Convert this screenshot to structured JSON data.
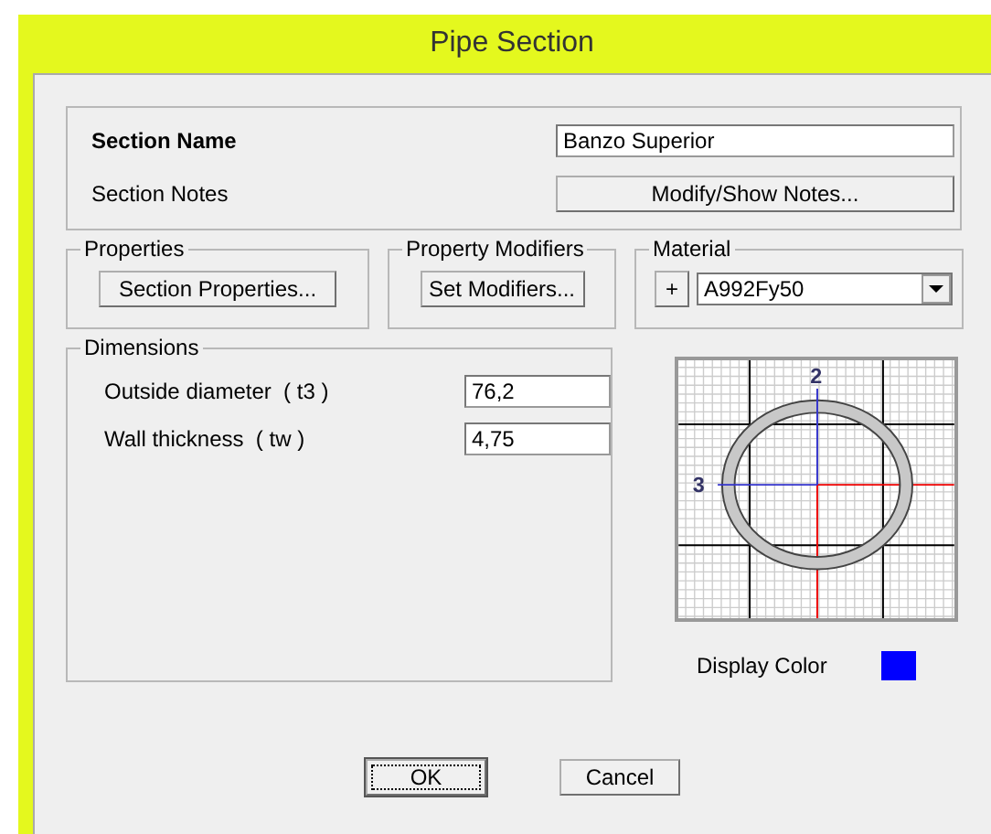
{
  "window": {
    "title": "Pipe Section"
  },
  "section": {
    "name_label": "Section Name",
    "name_value": "Banzo Superior",
    "notes_label": "Section Notes",
    "notes_button": "Modify/Show Notes..."
  },
  "properties": {
    "title": "Properties",
    "button": "Section Properties..."
  },
  "property_modifiers": {
    "title": "Property Modifiers",
    "button": "Set Modifiers..."
  },
  "material": {
    "title": "Material",
    "add_button": "+",
    "value": "A992Fy50"
  },
  "dimensions": {
    "title": "Dimensions",
    "fields": [
      {
        "label": "Outside diameter  ( t3 )",
        "value": "76,2"
      },
      {
        "label": "Wall thickness  ( tw )",
        "value": "4,75"
      }
    ]
  },
  "preview": {
    "axis_vertical": "2",
    "axis_horizontal": "3"
  },
  "display_color": {
    "label": "Display Color",
    "color": "#0000ff"
  },
  "buttons": [
    {
      "label": "OK",
      "default": true
    },
    {
      "label": "Cancel",
      "default": false
    }
  ]
}
